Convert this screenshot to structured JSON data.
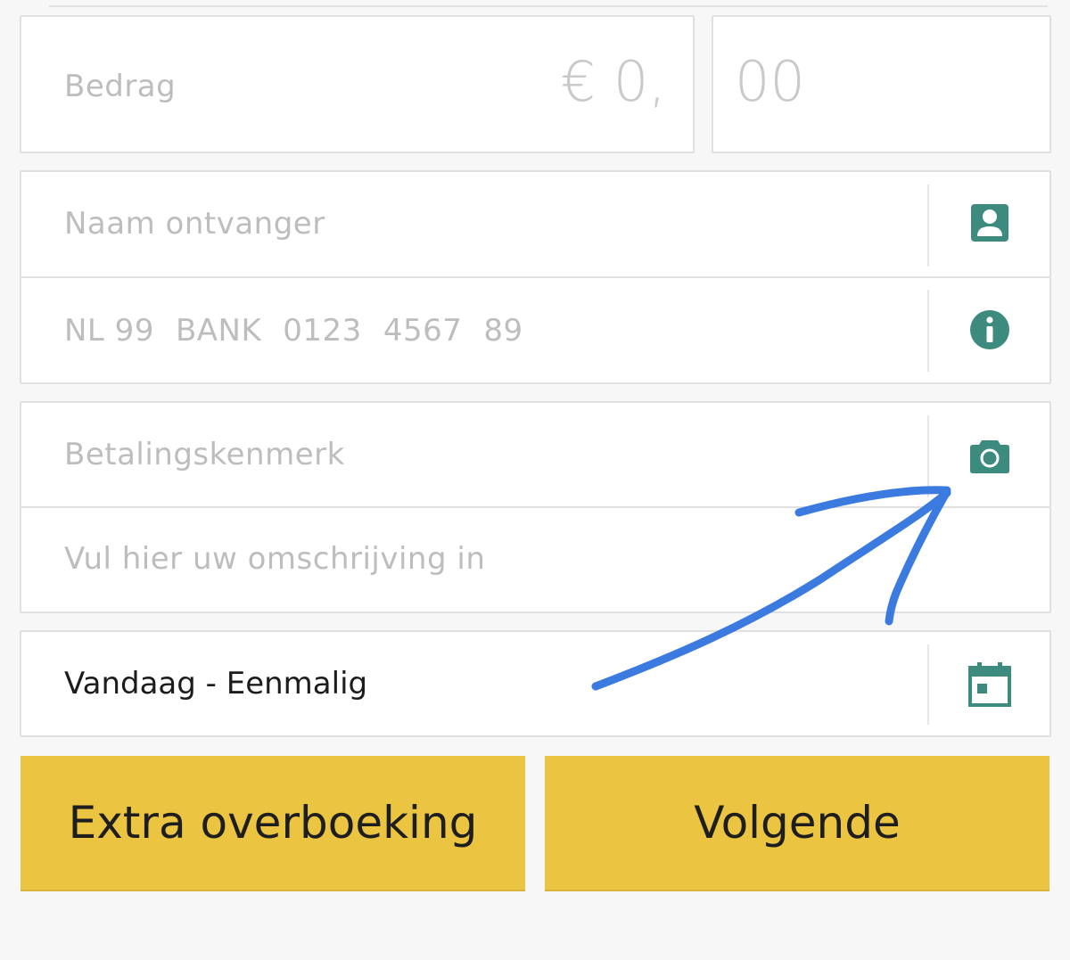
{
  "amount": {
    "label_placeholder": "Bedrag",
    "euro_placeholder": "€ 0,",
    "cents_placeholder": "00"
  },
  "recipient": {
    "name_placeholder": "Naam ontvanger",
    "iban_parts": [
      "NL 99",
      "BANK",
      "0123",
      "4567",
      "89"
    ]
  },
  "reference": {
    "kenmerk_placeholder": "Betalingskenmerk",
    "description_placeholder": "Vul hier uw omschrijving in"
  },
  "schedule": {
    "value": "Vandaag - Eenmalig"
  },
  "actions": {
    "extra_label": "Extra overboeking",
    "next_label": "Volgende"
  },
  "icons": {
    "contact": "contact-card-icon",
    "info": "info-icon",
    "camera": "camera-icon",
    "calendar": "calendar-icon"
  },
  "colors": {
    "accent": "#3d8b7f",
    "button": "#ebc442",
    "annotation": "#3b7be0"
  }
}
